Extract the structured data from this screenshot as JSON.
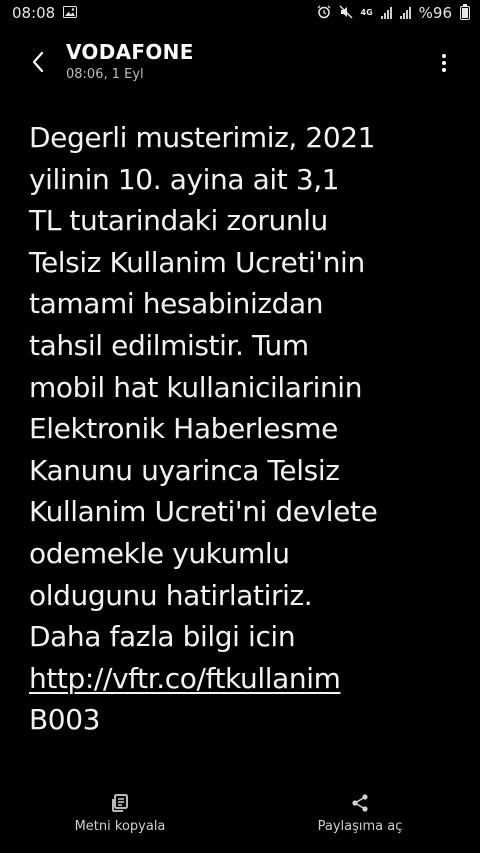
{
  "status_bar": {
    "time": "08:08",
    "battery": "%96",
    "network": "4G",
    "battery_level": 0.96,
    "icons": [
      "image-icon",
      "alarm-icon",
      "mute-icon",
      "signal-icon",
      "battery-icon"
    ]
  },
  "header": {
    "sender": "VODAFONE",
    "datetime": "08:06, 1 Eyl"
  },
  "message": {
    "lines": [
      "Degerli musterimiz, 2021",
      "yilinin 10. ayina ait 3,1",
      "TL tutarindaki zorunlu",
      "Telsiz Kullanim Ucreti'nin",
      "tamami hesabinizdan",
      "tahsil edilmistir. Tum",
      "mobil hat kullanicilarinin",
      "Elektronik Haberlesme",
      "Kanunu uyarinca Telsiz",
      "Kullanim Ucreti'ni devlete",
      "odemekle yukumlu",
      "oldugunu hatirlatiriz.",
      "Daha fazla bilgi icin"
    ],
    "link": "http://vftr.co/ftkullanim",
    "code": "B003"
  },
  "bottom_actions": {
    "copy_label": "Metni kopyala",
    "share_label": "Paylaşıma aç"
  }
}
